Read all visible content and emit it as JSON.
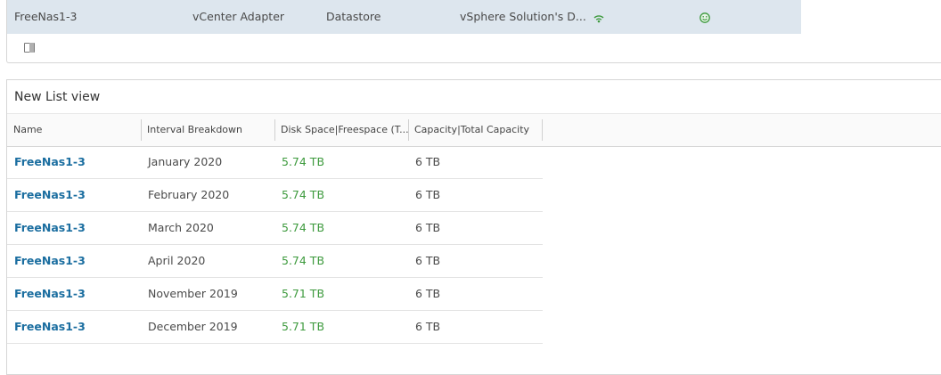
{
  "top_row": {
    "name": "FreeNas1-3",
    "adapter": "vCenter Adapter",
    "type": "Datastore",
    "solution": "vSphere Solution's D...",
    "signal_icon": "wifi-signal-icon",
    "status_icon": "smiley-health-icon",
    "status_color": "#3d9a3d"
  },
  "column_toggle_icon": "column-toggle-icon",
  "list_view": {
    "title": "New List view",
    "columns": [
      "Name",
      "Interval Breakdown",
      "Disk Space|Freespace (T...",
      "Capacity|Total Capacity"
    ],
    "rows": [
      {
        "name": "FreeNas1-3",
        "interval": "January 2020",
        "disk": "5.74 TB",
        "capacity": "6 TB"
      },
      {
        "name": "FreeNas1-3",
        "interval": "February 2020",
        "disk": "5.74 TB",
        "capacity": "6 TB"
      },
      {
        "name": "FreeNas1-3",
        "interval": "March 2020",
        "disk": "5.74 TB",
        "capacity": "6 TB"
      },
      {
        "name": "FreeNas1-3",
        "interval": "April 2020",
        "disk": "5.74 TB",
        "capacity": "6 TB"
      },
      {
        "name": "FreeNas1-3",
        "interval": "November 2019",
        "disk": "5.71 TB",
        "capacity": "6 TB"
      },
      {
        "name": "FreeNas1-3",
        "interval": "December 2019",
        "disk": "5.71 TB",
        "capacity": "6 TB"
      }
    ],
    "link_color": "#1b6ea0",
    "value_color": "#3d9a3d"
  }
}
